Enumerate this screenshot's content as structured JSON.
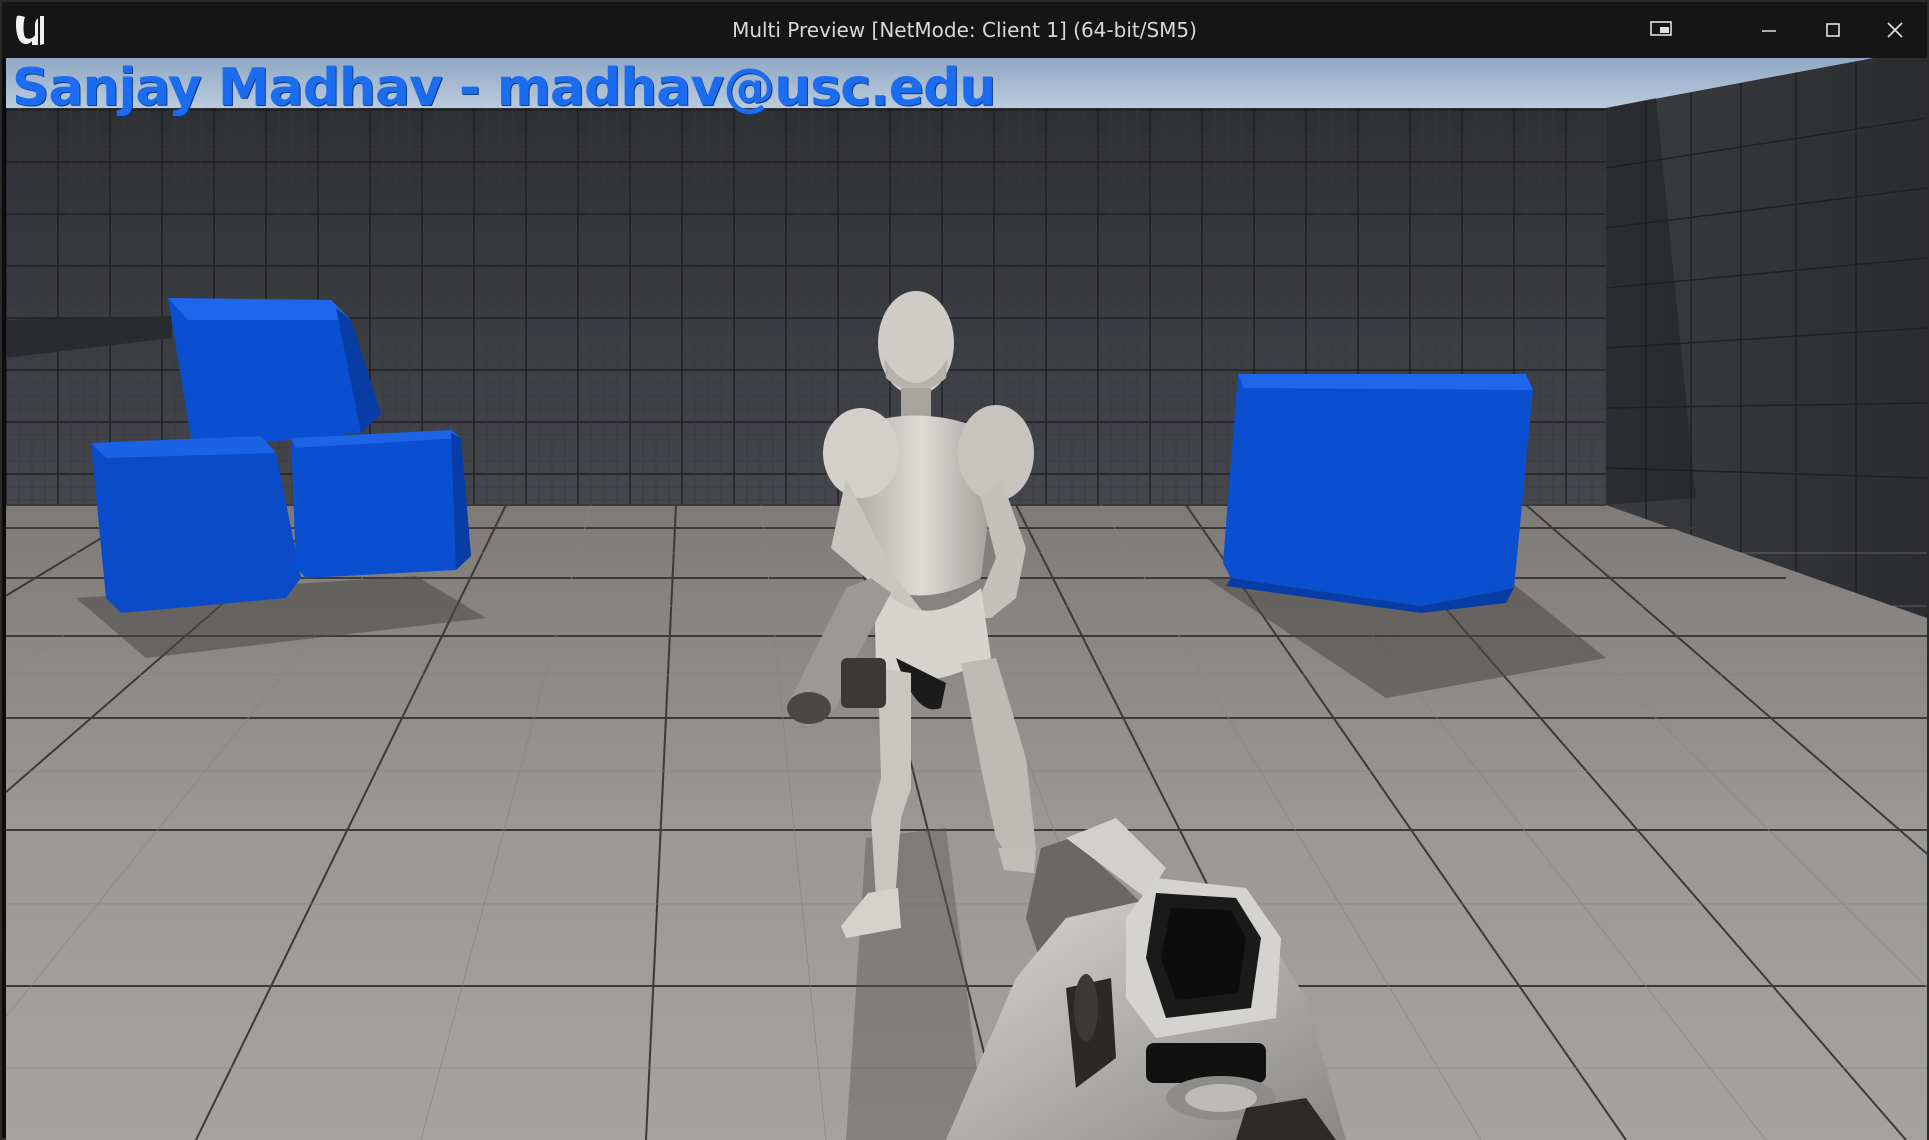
{
  "window": {
    "title": "Multi Preview [NetMode: Client 1]  (64-bit/SM5)",
    "icons": {
      "logo": "unreal-engine-logo",
      "extra": "screen-capture-icon",
      "minimize": "minimize-icon",
      "maximize": "maximize-icon",
      "close": "close-icon"
    }
  },
  "overlay": {
    "text": "Sanjay Madhav - madhav@usc.edu",
    "color": "#1c6cf0"
  },
  "scene": {
    "colors": {
      "sky": "#a9bfd6",
      "wall": "#3d3f44",
      "floor": "#8e8b88",
      "cube": "#0b4fd1",
      "mannequin": "#c9c6c2"
    }
  }
}
